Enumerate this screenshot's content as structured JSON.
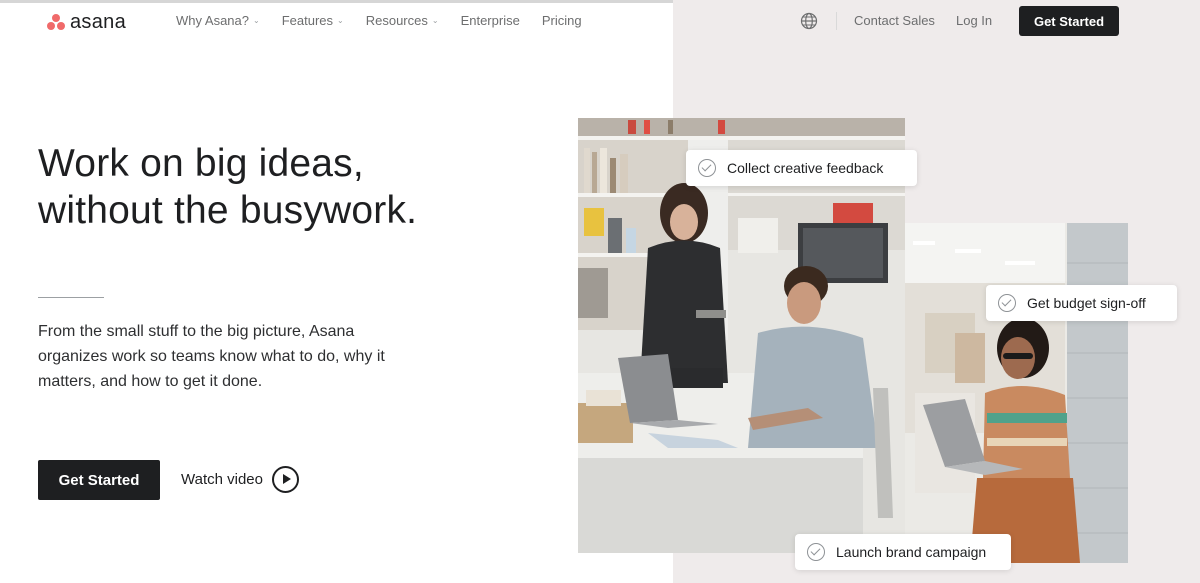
{
  "brand": {
    "name": "asana",
    "color": "#f06a6a"
  },
  "nav": {
    "items": [
      {
        "label": "Why Asana?",
        "has_dropdown": true
      },
      {
        "label": "Features",
        "has_dropdown": true
      },
      {
        "label": "Resources",
        "has_dropdown": true
      },
      {
        "label": "Enterprise",
        "has_dropdown": false
      },
      {
        "label": "Pricing",
        "has_dropdown": false
      }
    ],
    "globe_icon": "globe-icon",
    "contact_sales": "Contact Sales",
    "log_in": "Log In",
    "get_started": "Get Started"
  },
  "hero": {
    "headline_line1": "Work on big ideas,",
    "headline_line2": "without the busywork.",
    "subtext": "From the small stuff to the big picture, Asana organizes work so teams know what to do, why it matters, and how to get it done.",
    "cta_primary": "Get Started",
    "cta_secondary": "Watch video",
    "play_icon": "play-circle-icon"
  },
  "task_cards": [
    {
      "label": "Collect creative feedback"
    },
    {
      "label": "Get budget sign-off"
    },
    {
      "label": "Launch brand campaign"
    }
  ],
  "colors": {
    "dark": "#1e1f21",
    "accent": "#f06a6a",
    "panel_bg": "#efebeb"
  }
}
